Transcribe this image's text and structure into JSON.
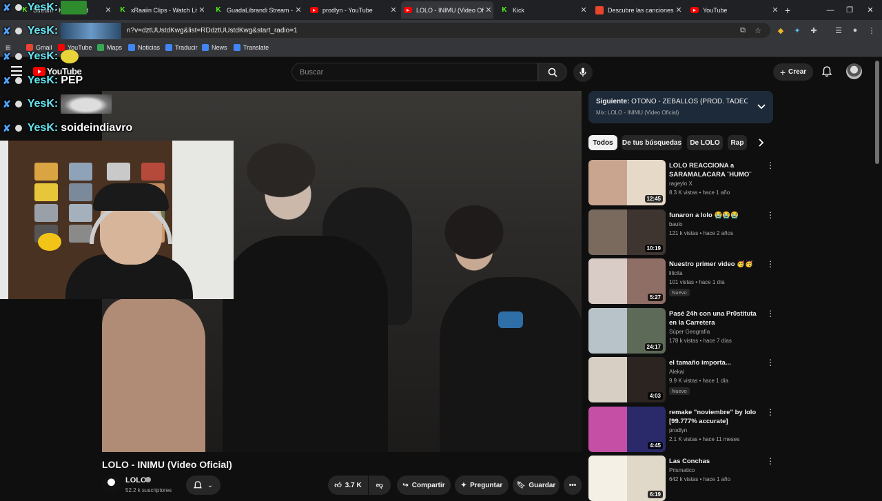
{
  "browser": {
    "tabs": [
      {
        "title": "Stream - Kick Board",
        "icon": "kick",
        "active": false
      },
      {
        "title": "xRaaiin Clips - Watch Live",
        "icon": "kick",
        "active": false
      },
      {
        "title": "GuadaLibrandi Stream - V",
        "icon": "kick",
        "active": false
      },
      {
        "title": "prodlyn - YouTube",
        "icon": "youtube",
        "active": false
      },
      {
        "title": "LOLO - INIMU (Video Ofic",
        "icon": "youtube",
        "active": true
      },
      {
        "title": "Kick",
        "icon": "kick",
        "active": false
      },
      {
        "title": "Descubre las canciones m",
        "icon": "music",
        "active": false
      },
      {
        "title": "YouTube",
        "icon": "youtube",
        "active": false
      }
    ],
    "new_tab": "+",
    "url": "n?v=dztUUstdKwg&list=RDdztUUstdKwg&start_radio=1",
    "bookmarks": [
      "Gmail",
      "YouTube",
      "Maps",
      "Noticias",
      "Traducir",
      "News",
      "Translate"
    ]
  },
  "youtube": {
    "logo_text": "YouTube",
    "search_placeholder": "Buscar",
    "create_label": "Crear",
    "video_title": "LOLO - INIMU (Video Oficial)",
    "channel_name": "LOLO",
    "channel_subs": "52.2 k suscriptores",
    "likes": "3.7 K",
    "share_label": "Compartir",
    "ask_label": "Preguntar",
    "save_label": "Guardar",
    "more_label": "•••"
  },
  "chat": [
    {
      "user": "YesK:",
      "text": ""
    },
    {
      "user": "YesK:",
      "text": ""
    },
    {
      "user": "YesK:",
      "text": "PEP"
    },
    {
      "user": "YesK:",
      "text": ""
    },
    {
      "user": "YesK:",
      "text": "soideindiavro"
    }
  ],
  "upnext": {
    "label": "Siguiente:",
    "title": "OTOÑO - ZEBALLOS (PROD. TADEO VAZ...",
    "mix": "Mix: LOLO - INIMU (Video Oficial)"
  },
  "chips": [
    "Todos",
    "De tus búsquedas",
    "De LOLO",
    "Rap"
  ],
  "recommendations": [
    {
      "title": "LOLO REACCIONA a SARAMALACARA ¨HUMO¨",
      "channel": "rageylo X",
      "meta": "8.3 K vistas • hace 1 año",
      "duration": "12:45",
      "badge": "",
      "c1": "#c9a58f",
      "c2": "#e6d9c8"
    },
    {
      "title": "funaron a lolo 😭😭😭",
      "channel": "baulo",
      "meta": "121 k vistas • hace 2 años",
      "duration": "10:19",
      "badge": "",
      "c1": "#7a6a5e",
      "c2": "#3f3530"
    },
    {
      "title": "Nuestro primer video 🥳🥳",
      "channel": "lilicita",
      "meta": "101 vistas • hace 1 día",
      "duration": "5:27",
      "badge": "Nuevo",
      "c1": "#d9ccc7",
      "c2": "#8f6e66"
    },
    {
      "title": "Pasé 24h con una Pr0stituta en la Carretera",
      "channel": "Súper Geografía",
      "meta": "178 k vistas • hace 7 días",
      "duration": "24:17",
      "badge": "",
      "c1": "#b8c2c9",
      "c2": "#5e6a58"
    },
    {
      "title": "el tamaño importa...",
      "channel": "Alekai",
      "meta": "9.9 K vistas • hace 1 día",
      "duration": "4:03",
      "badge": "Nuevo",
      "c1": "#d8cfc4",
      "c2": "#2b2420"
    },
    {
      "title": "remake \"noviembre\" by lolo [99.777% accurate]",
      "channel": "prodlyn",
      "meta": "2.1 K vistas • hace 11 meses",
      "duration": "4:45",
      "badge": "",
      "c1": "#c54fa4",
      "c2": "#2a2a6a"
    },
    {
      "title": "Las Conchas",
      "channel": "Prismatico",
      "meta": "642 k vistas • hace 1 año",
      "duration": "6:19",
      "badge": "",
      "c1": "#f5f0e6",
      "c2": "#e0d8c8"
    }
  ],
  "colors": {
    "youtube_red": "#ff0000",
    "kick_green": "#53fc18",
    "upnext_bg": "#1d2a3a",
    "chat_user": "#66e8f5"
  }
}
